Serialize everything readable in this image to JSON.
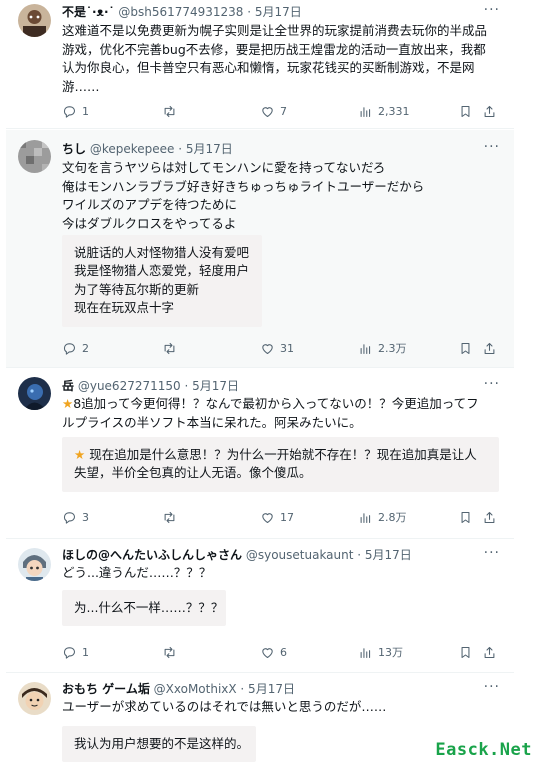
{
  "tweets": [
    {
      "name": "不是˙·ᴥ·˙",
      "meta": "@bsh561774931238 · 5月17日",
      "more": "···",
      "lines": [
        "这难道不是以免费更新为幌子实则是让全世界的玩家提前消费去玩你的半成品",
        "游戏，优化不完善bug不去修，要是把历战王煌雷龙的活动一直放出来，我都",
        "认为你良心，但卡普空只有恶心和懒惰，玩家花钱买的买断制游戏，不是网",
        "游……"
      ],
      "translation": [],
      "stats": {
        "reply": "1",
        "retweet": "",
        "like": "7",
        "views": "2,331"
      }
    },
    {
      "name": "ちし",
      "meta": "@kepekepeee · 5月17日",
      "more": "···",
      "lines": [
        "文句を言うヤツらは対してモンハンに愛を持ってないだろ",
        "俺はモンハンラブラブ好き好きちゅっちゅライトユーザーだから",
        "ワイルズのアプデを待つために",
        "今はダブルクロスをやってるよ"
      ],
      "translation": [
        "说脏话的人对怪物猎人没有爱吧",
        "我是怪物猎人恋爱党，轻度用户",
        "为了等待瓦尔斯的更新",
        "现在在玩双点十字"
      ],
      "stats": {
        "reply": "2",
        "retweet": "",
        "like": "31",
        "views": "2.3万"
      }
    },
    {
      "name": "岳",
      "meta": "@yue627271150 · 5月17日",
      "more": "···",
      "lines": [
        "8追加って今更何得！？なんで最初から入ってないの！？今更追加ってフ",
        "ルプライスの半ソフト本当に呆れた。阿呆みたいに。"
      ],
      "translation": [
        "现在追加是什么意思！？为什么一开始就不存在！？现在追加真是让人",
        "失望，半价全包真的让人无语。像个傻瓜。"
      ],
      "stats": {
        "reply": "3",
        "retweet": "",
        "like": "17",
        "views": "2.8万"
      }
    },
    {
      "name": "ほしの@へんたいふしんしゃさん",
      "meta": "@syousetuakaunt · 5月17日",
      "more": "···",
      "lines": [
        "どう...違うんだ……？？？"
      ],
      "translation": [
        "为...什么不一样……？？？"
      ],
      "stats": {
        "reply": "1",
        "retweet": "",
        "like": "6",
        "views": "13万"
      }
    },
    {
      "name": "おもち ゲーム垢",
      "meta": "@XxoMothixX · 5月17日",
      "more": "···",
      "lines": [
        "ユーザーが求めているのはそれでは無いと思うのだが……"
      ],
      "translation": [
        "我认为用户想要的不是这样的。"
      ],
      "stats": {
        "reply": "",
        "retweet": "",
        "like": "",
        "views": ""
      }
    }
  ],
  "watermark": "Easck.Net",
  "colors": {
    "text": "#0f1419",
    "muted": "#536471",
    "translation_bg": "#f4f2f2",
    "star": "#f0a420",
    "watermark": "#19a34a"
  }
}
